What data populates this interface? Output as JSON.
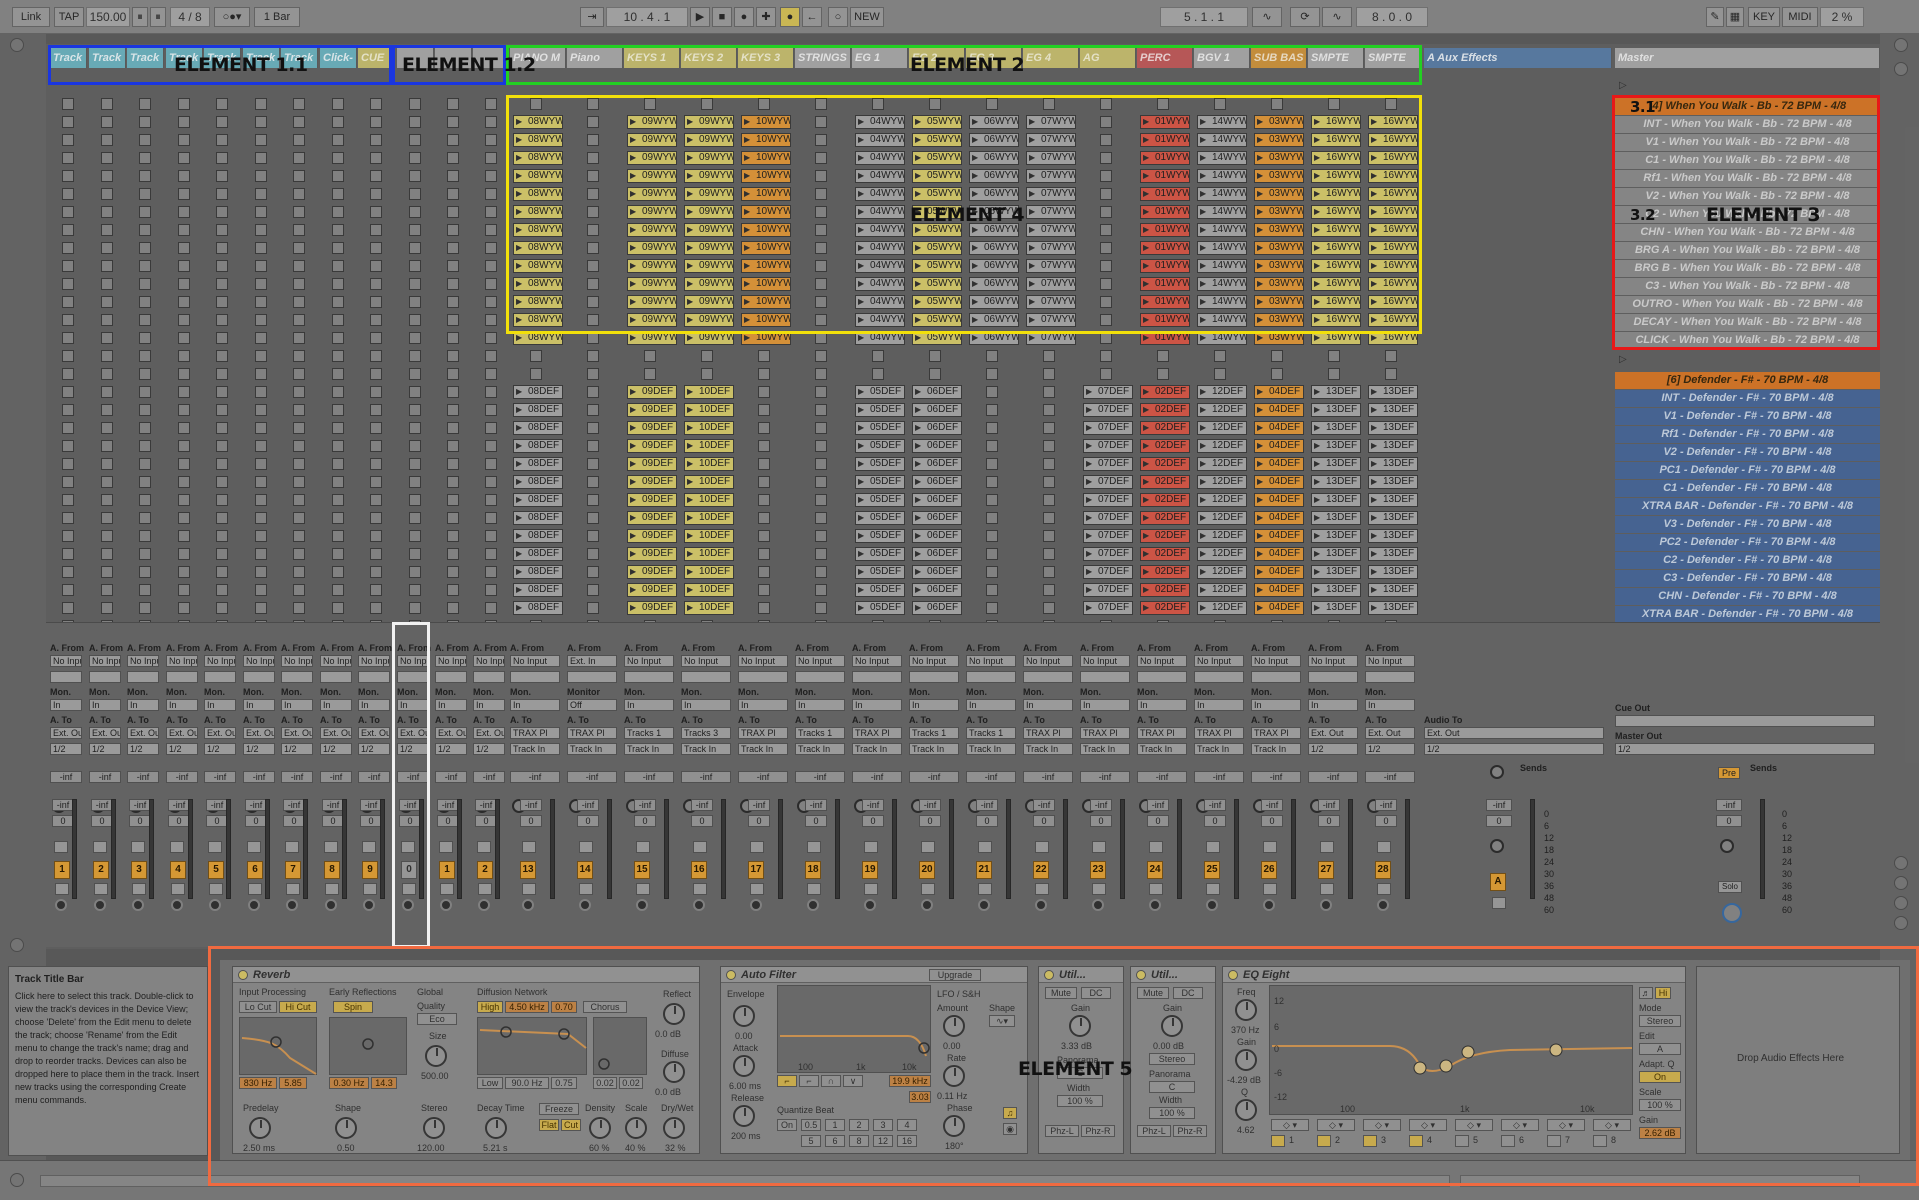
{
  "transport": {
    "link": "Link",
    "tap": "TAP",
    "bpm": "150.00",
    "sig": "4 / 8",
    "quantize": "1 Bar",
    "position": "10 .  4 .  1",
    "arrangement_pos": "5 .  1 .  1",
    "loop_len": "8 .  0 .  0",
    "new_label": "NEW",
    "key_label": "KEY",
    "midi_label": "MIDI",
    "cpu": "2 %"
  },
  "headers": {
    "grp1": [
      "Track",
      "Track",
      "Track",
      "Track",
      "Track",
      "Track",
      "Track",
      "Click-",
      "CUE"
    ],
    "grp2": [
      "PIANO M",
      "Piano",
      "KEYS 1",
      "KEYS 2",
      "KEYS 3",
      "STRINGS",
      "EG 1",
      "EG 2",
      "EG 3",
      "EG 4",
      "AG",
      "PERC",
      "BGV 1",
      "SUB BAS",
      "SMPTE",
      "SMPTE"
    ],
    "aux": "A Aux Effects",
    "master": "Master"
  },
  "clips_top": [
    "08WYW",
    "",
    "09WYW",
    "09WYW",
    "10WYW",
    "",
    "04WYW",
    "05WYW",
    "06WYW",
    "07WYW",
    "",
    "01WYW",
    "14WYW",
    "03WYW",
    "16WYW",
    "16WYW"
  ],
  "clips_bottom": [
    "08DEF",
    "",
    "09DEF",
    "10DEF",
    "",
    "",
    "05DEF",
    "06DEF",
    "",
    "",
    "07DEF",
    "02DEF",
    "12DEF",
    "04DEF",
    "13DEF",
    "13DEF"
  ],
  "scenes_top": [
    "[4] When You Walk - Bb - 72 BPM - 4/8",
    "INT - When You Walk - Bb - 72 BPM - 4/8",
    "V1 - When You Walk - Bb - 72 BPM - 4/8",
    "C1 - When You Walk - Bb - 72 BPM - 4/8",
    "Rf1 - When You Walk - Bb - 72 BPM - 4/8",
    "V2 - When You Walk - Bb - 72 BPM - 4/8",
    "C2 - When You Walk - Bb - 72 BPM - 4/8",
    "CHN - When You Walk - Bb - 72 BPM - 4/8",
    "BRG A - When You Walk - Bb - 72 BPM - 4/8",
    "BRG B - When You Walk - Bb - 72 BPM - 4/8",
    "C3 - When You Walk - Bb - 72 BPM - 4/8",
    "OUTRO - When You Walk - Bb - 72 BPM - 4/8",
    "DECAY - When You Walk - Bb - 72 BPM - 4/8",
    "CLICK - When You Walk - Bb - 72 BPM - 4/8"
  ],
  "scenes_bottom": [
    "[6] Defender - F# - 70 BPM - 4/8",
    "INT - Defender - F# - 70 BPM - 4/8",
    "V1 - Defender - F# - 70 BPM - 4/8",
    "Rf1 - Defender - F# - 70 BPM - 4/8",
    "V2 - Defender - F# - 70 BPM - 4/8",
    "PC1 - Defender - F# - 70 BPM - 4/8",
    "C1 - Defender - F# - 70 BPM - 4/8",
    "XTRA BAR - Defender - F# - 70 BPM - 4/8",
    "V3 - Defender - F# - 70 BPM - 4/8",
    "PC2 - Defender - F# - 70 BPM - 4/8",
    "C2 - Defender - F# - 70 BPM - 4/8",
    "C3 - Defender - F# - 70 BPM - 4/8",
    "CHN - Defender - F# - 70 BPM - 4/8",
    "XTRA BAR - Defender - F# - 70 BPM - 4/8"
  ],
  "mixer": {
    "a_from": "A. From",
    "a_to": "A. To",
    "mon": "Mon.",
    "monitor": "Monitor",
    "no_input": "No Input",
    "ext_in": "Ext. In",
    "in": "In",
    "off": "Off",
    "ext_out": "Ext. Out",
    "track_in": "Track In",
    "trax": "TRAX Pl",
    "tracks1": "Tracks 1",
    "tracks3": "Tracks 3",
    "inf": "-inf",
    "zero": "0",
    "audio_to": "Audio To",
    "cue_out": "Cue Out",
    "master_out": "Master Out",
    "sends": "Sends",
    "pre": "Pre",
    "solo": "Solo",
    "half": "1/2",
    "channel_numbers": [
      "1",
      "2",
      "3",
      "4",
      "5",
      "6",
      "7",
      "8",
      "9",
      "0",
      "1",
      "2",
      "13",
      "14",
      "15",
      "16",
      "17",
      "18",
      "19",
      "20",
      "21",
      "22",
      "23",
      "24",
      "25",
      "26",
      "27",
      "28"
    ],
    "aux_letter": "A",
    "db_scale": [
      "0",
      "6",
      "12",
      "18",
      "24",
      "30",
      "36",
      "48",
      "60"
    ]
  },
  "info": {
    "title": "Track Title Bar",
    "body": "Click here to select this track. Double-click to view the track's devices in the Device View; choose 'Delete' from the Edit menu to delete the track; choose 'Rename' from the Edit menu to change the track's name; drag and drop to reorder tracks. Devices can also be dropped here to place them in the track. Insert new tracks using the corresponding Create menu commands."
  },
  "devices": {
    "reverb": {
      "title": "Reverb",
      "input_processing": "Input Processing",
      "early_reflections": "Early Reflections",
      "global": "Global",
      "diffusion": "Diffusion Network",
      "reflect": "Reflect",
      "lo_cut": "Lo Cut",
      "hi_cut": "Hi Cut",
      "spin": "Spin",
      "quality": "Quality",
      "eco": "Eco",
      "size": "Size",
      "size_val": "500.00",
      "high": "High",
      "high_freq": "4.50 kHz",
      "high_val": "0.70",
      "chorus": "Chorus",
      "reflect_db": "0.0 dB",
      "diffuse": "Diffuse",
      "diffuse_db": "0.0 dB",
      "f1": "830 Hz",
      "f2": "5.85",
      "f3": "0.30 Hz",
      "f4": "14.3",
      "low": "Low",
      "low_freq": "90.0 Hz",
      "low_val": "0.75",
      "v1": "0.02",
      "v2": "0.02",
      "predelay": "Predelay",
      "predelay_val": "2.50 ms",
      "shape": "Shape",
      "shape_val": "0.50",
      "stereo": "Stereo",
      "stereo_val": "120.00",
      "decay": "Decay Time",
      "decay_val": "5.21 s",
      "freeze": "Freeze",
      "flat": "Flat",
      "cut": "Cut",
      "density": "Density",
      "density_val": "60 %",
      "scale": "Scale",
      "scale_val": "40 %",
      "drywet": "Dry/Wet",
      "drywet_val": "32 %"
    },
    "autofilter": {
      "title": "Auto Filter",
      "upgrade": "Upgrade",
      "envelope": "Envelope",
      "env_val": "0.00",
      "attack": "Attack",
      "attack_val": "6.00 ms",
      "release": "Release",
      "release_val": "200 ms",
      "lfo": "LFO / S&H",
      "amount": "Amount",
      "amount_val": "0.00",
      "shape": "Shape",
      "rate": "Rate",
      "rate_val": "0.11 Hz",
      "phase": "Phase",
      "phase_val": "180°",
      "freq": "19.9 kHz",
      "q": "3.03",
      "quantize_beat": "Quantize Beat",
      "on": "On",
      "beats_row1": [
        "0.5",
        "1",
        "2",
        "3",
        "4"
      ],
      "beats_row2": [
        "5",
        "6",
        "8",
        "12",
        "16"
      ],
      "axis": [
        "100",
        "1k",
        "10k"
      ]
    },
    "util1": {
      "title": "Util...",
      "mute": "Mute",
      "dc": "DC",
      "gain": "Gain",
      "gain_val": "3.33 dB",
      "panorama": "Panorama",
      "pan_val": "C",
      "width": "Width",
      "width_val": "100 %",
      "phz_l": "Phz-L",
      "phz_r": "Phz-R"
    },
    "util2": {
      "title": "Util...",
      "mute": "Mute",
      "dc": "DC",
      "gain": "Gain",
      "gain_val": "0.00 dB",
      "stereo": "Stereo",
      "panorama": "Panorama",
      "pan_val": "C",
      "width": "Width",
      "width_val": "100 %",
      "phz_l": "Phz-L",
      "phz_r": "Phz-R"
    },
    "eq": {
      "title": "EQ Eight",
      "freq": "Freq",
      "freq_val": "370 Hz",
      "gain": "Gain",
      "gain_val": "-4.29 dB",
      "q": "Q",
      "q_val": "4.62",
      "mode": "Mode",
      "mode_val": "Stereo",
      "edit": "Edit",
      "edit_val": "A",
      "adapt": "Adapt. Q",
      "adapt_val": "On",
      "scale": "Scale",
      "scale_val": "100 %",
      "out_gain": "Gain",
      "out_gain_val": "2.62 dB",
      "bands": [
        "1",
        "2",
        "3",
        "4",
        "5",
        "6",
        "7",
        "8"
      ],
      "axis_db": [
        "12",
        "6",
        "0",
        "-6",
        "-12"
      ],
      "axis_hz": [
        "100",
        "1k",
        "10k"
      ]
    },
    "drop": "Drop Audio Effects Here"
  },
  "annotations": {
    "e11": "ELEMENT 1.1",
    "e12": "ELEMENT 1.2",
    "e2": "ELEMENT 2",
    "e3": "ELEMENT 3",
    "e31": "3.1",
    "e32": "3.2",
    "e4": "ELEMENT 4",
    "e5": "ELEMENT 5"
  },
  "colors": {
    "blue_box": "#1a36e0",
    "green_box": "#22d022",
    "yellow_box": "#f2e00a",
    "red_box": "#e81818",
    "orange_box": "#f06a40",
    "white_box": "#f1f1f1",
    "clip_yellow": "#d8cc6e",
    "clip_orange": "#e29a3c",
    "clip_red": "#d95a4a",
    "clip_grey": "#a9a9a9"
  }
}
